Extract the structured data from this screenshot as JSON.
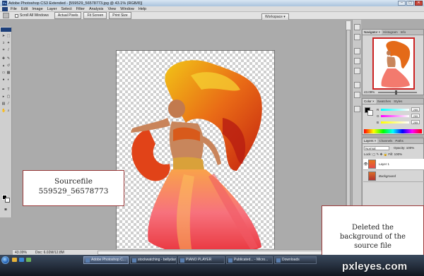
{
  "window": {
    "title": "Adobe Photoshop CS3 Extended - [559529_56578773.jpg @ 43.1% (RGB/8)]",
    "minimize": "–",
    "maximize": "▢",
    "close": "✕"
  },
  "menu": [
    "File",
    "Edit",
    "Image",
    "Layer",
    "Select",
    "Filter",
    "Analysis",
    "View",
    "Window",
    "Help"
  ],
  "options": {
    "scroll_all_windows": "Scroll All Windows",
    "actual_pixels": "Actual Pixels",
    "fit_screen": "Fit Screen",
    "print_size": "Print Size",
    "workspace": "Workspace ▾"
  },
  "status": {
    "zoom": "43.09%",
    "doc": "Doc: 6.02M/12.8M"
  },
  "navigator": {
    "tabs": [
      "Navigator ×",
      "Histogram",
      "Info"
    ],
    "zoom": "43.09%"
  },
  "color_panel": {
    "tabs": [
      "Color ×",
      "Swatches",
      "Styles"
    ],
    "channels": [
      {
        "label": "R",
        "value": "255",
        "color": "#ff0000"
      },
      {
        "label": "G",
        "value": "255",
        "color": "#00c000"
      },
      {
        "label": "B",
        "value": "255",
        "color": "#0000ff"
      }
    ]
  },
  "layers_panel": {
    "tabs": [
      "Layers ×",
      "Channels",
      "Paths"
    ],
    "blend_mode": "Normal",
    "opacity": "Opacity: 100%",
    "lock_fill": "Lock:  ▢ ✎ ✥ 🔒   Fill: 100%",
    "layers": [
      {
        "name": "Layer 1",
        "visible": "👁",
        "selected": true
      },
      {
        "name": "Background",
        "visible": "",
        "selected": false
      }
    ]
  },
  "notes": {
    "source_line1": "Sourcefile",
    "source_line2": "559529_56578773",
    "deleted_line1": "Deleted the",
    "deleted_line2": "background of the",
    "deleted_line3": "source file"
  },
  "taskbar": [
    {
      "label": "Adobe Photoshop C...",
      "active": true
    },
    {
      "label": "stockwatching - bellydance",
      "active": false
    },
    {
      "label": "PIANO PLAYER",
      "active": false
    },
    {
      "label": "Publicated... - Micro...",
      "active": false
    },
    {
      "label": "Downloads",
      "active": false
    }
  ],
  "watermark": "pxleyes.com"
}
